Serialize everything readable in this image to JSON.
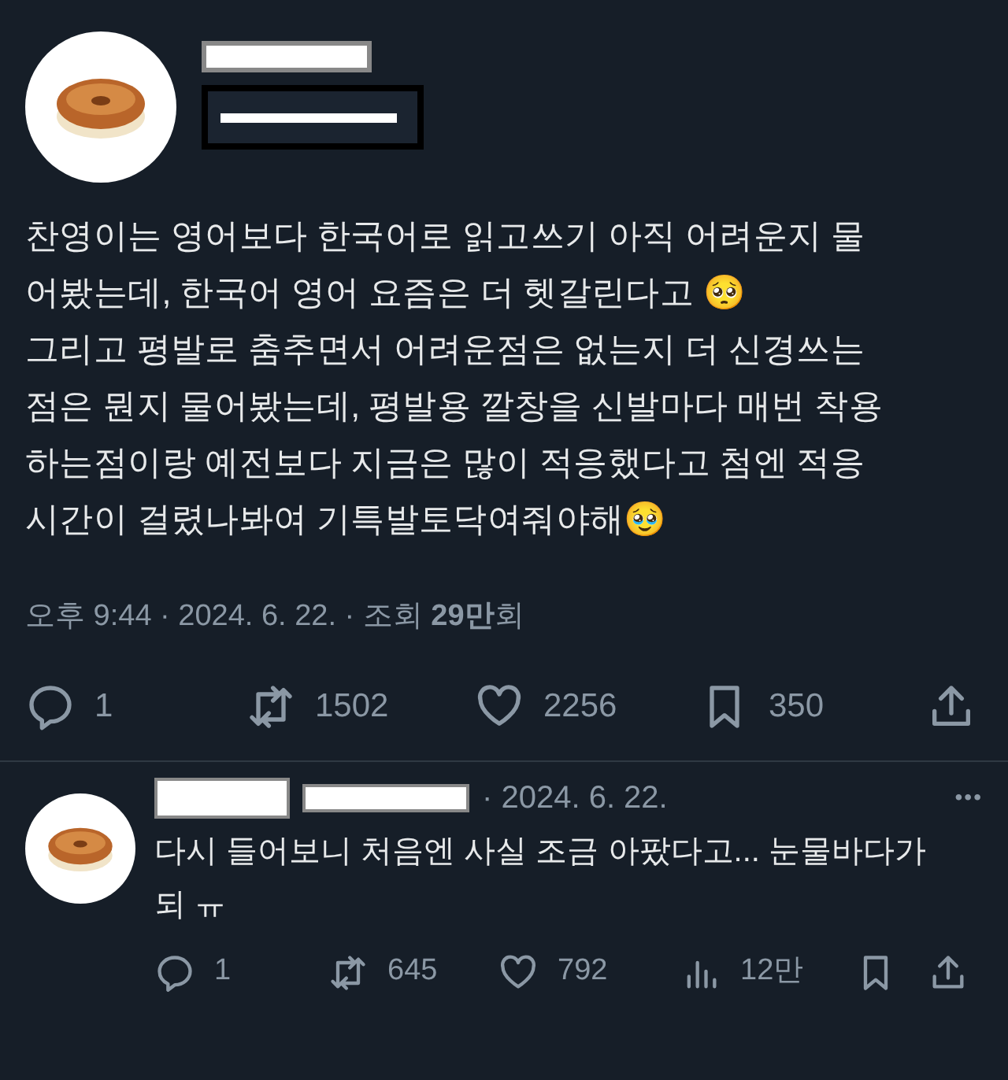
{
  "tweet": {
    "body": "찬영이는 영어보다 한국어로 읽고쓰기 아직 어려운지 물\n어봤는데, 한국어 영어 요즘은 더 헷갈린다고 🥺\n그리고 평발로 춤추면서 어려운점은 없는지 더 신경쓰는\n점은 뭔지 물어봤는데, 평발용 깔창을 신발마다 매번 착용\n하는점이랑 예전보다 지금은 많이 적응했다고 첨엔 적응\n시간이 걸렸나봐여 기특발토닥여줘야해🥹",
    "meta": "오후 9:44 · 2024. 6. 22. · 조회 **29만**회",
    "actions": [
      {
        "kind": "reply",
        "count": "1"
      },
      {
        "kind": "retweet",
        "count": "1502"
      },
      {
        "kind": "like",
        "count": "2256"
      },
      {
        "kind": "bookmark",
        "count": "350"
      },
      {
        "kind": "share"
      }
    ]
  },
  "reply": {
    "date": "· 2024. 6. 22.",
    "more": "•••",
    "body": "다시 들어보니 처음엔 사실 조금 아팠다고... 눈물바다가\n되 ㅠ",
    "actions": [
      {
        "kind": "reply",
        "count": "1"
      },
      {
        "kind": "retweet",
        "count": "645"
      },
      {
        "kind": "like",
        "count": "792"
      },
      {
        "kind": "views",
        "count": "12만"
      },
      {
        "kind": "bookmark"
      },
      {
        "kind": "share"
      }
    ]
  }
}
